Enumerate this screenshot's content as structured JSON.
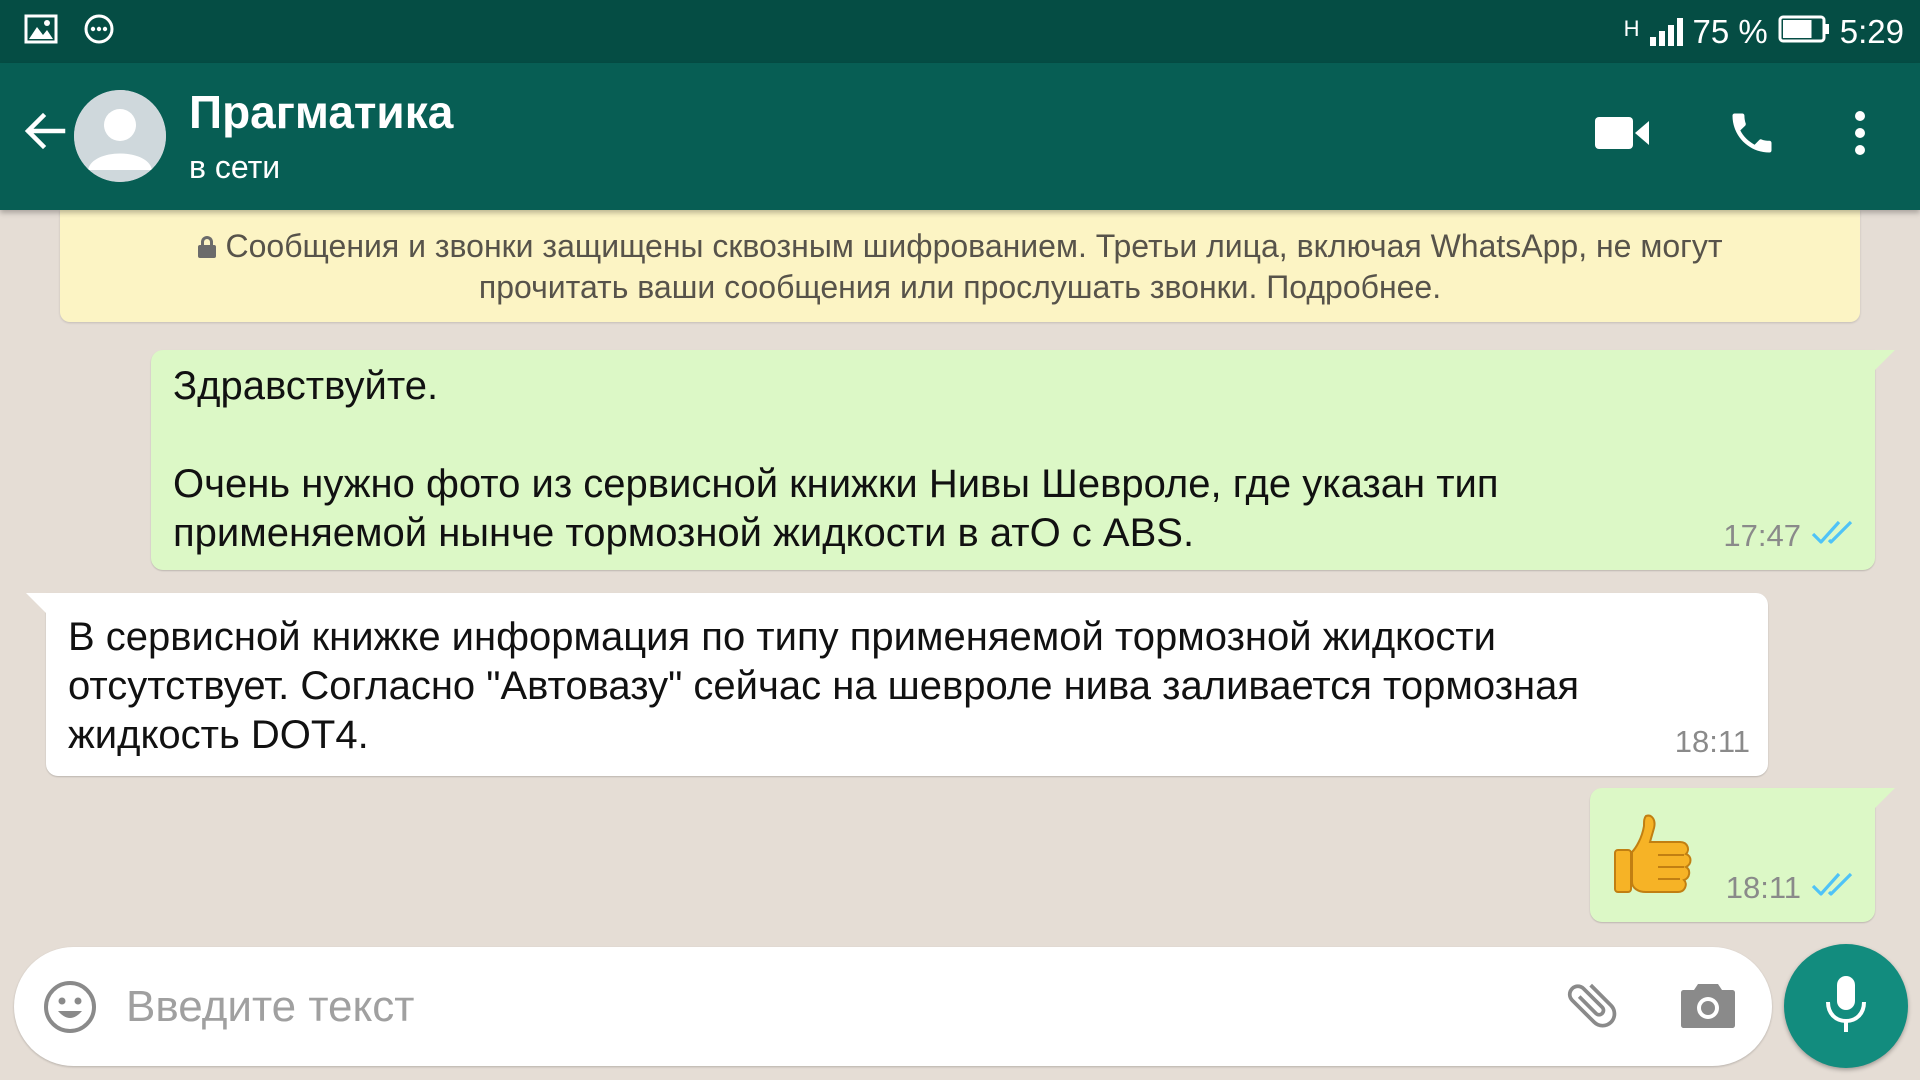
{
  "status_bar": {
    "network_type": "H",
    "battery_percent": "75 %",
    "time": "5:29",
    "left_icons": [
      "image-icon",
      "chat-bubble-icon"
    ],
    "battery_level": 0.75
  },
  "header": {
    "contact_name": "Прагматика",
    "contact_status": "в сети",
    "icons": [
      "back-arrow-icon",
      "avatar-placeholder-icon",
      "video-call-icon",
      "phone-icon",
      "more-vert-icon"
    ]
  },
  "encryption_notice": {
    "line1": "Сообщения и звонки защищены сквозным шифрованием. Третьи лица, включая WhatsApp, не могут",
    "line2": "прочитать ваши сообщения или прослушать звонки. Подробнее."
  },
  "messages": [
    {
      "direction": "outgoing",
      "text": "Здравствуйте.\n\nОчень нужно фото из сервисной книжки Нивы Шевроле, где указан тип\nприменяемой нынче тормозной жидкости в атО с ABS.",
      "time": "17:47",
      "status": "read"
    },
    {
      "direction": "incoming",
      "text": "В сервисной книжке информация по типу применяемой тормозной жидкости\nотсутствует. Согласно \"Автовазу\" сейчас на шевроле нива заливается тормозная\nжидкость DOT4.",
      "time": "18:11"
    },
    {
      "direction": "outgoing",
      "emoji": "thumbs-up",
      "time": "18:11",
      "status": "read"
    }
  ],
  "input": {
    "placeholder": "Введите текст",
    "icons": [
      "emoji-icon",
      "attach-icon",
      "camera-icon",
      "mic-icon"
    ]
  },
  "colors": {
    "status_bar": "#054d44",
    "app_bar": "#075e54",
    "chat_background": "#e5ddd5",
    "outgoing_bubble": "#dcf8c6",
    "incoming_bubble": "#ffffff",
    "encryption_notice": "#fcf4c4",
    "read_ticks": "#4fc3f7",
    "mic_button": "#128c7e"
  }
}
